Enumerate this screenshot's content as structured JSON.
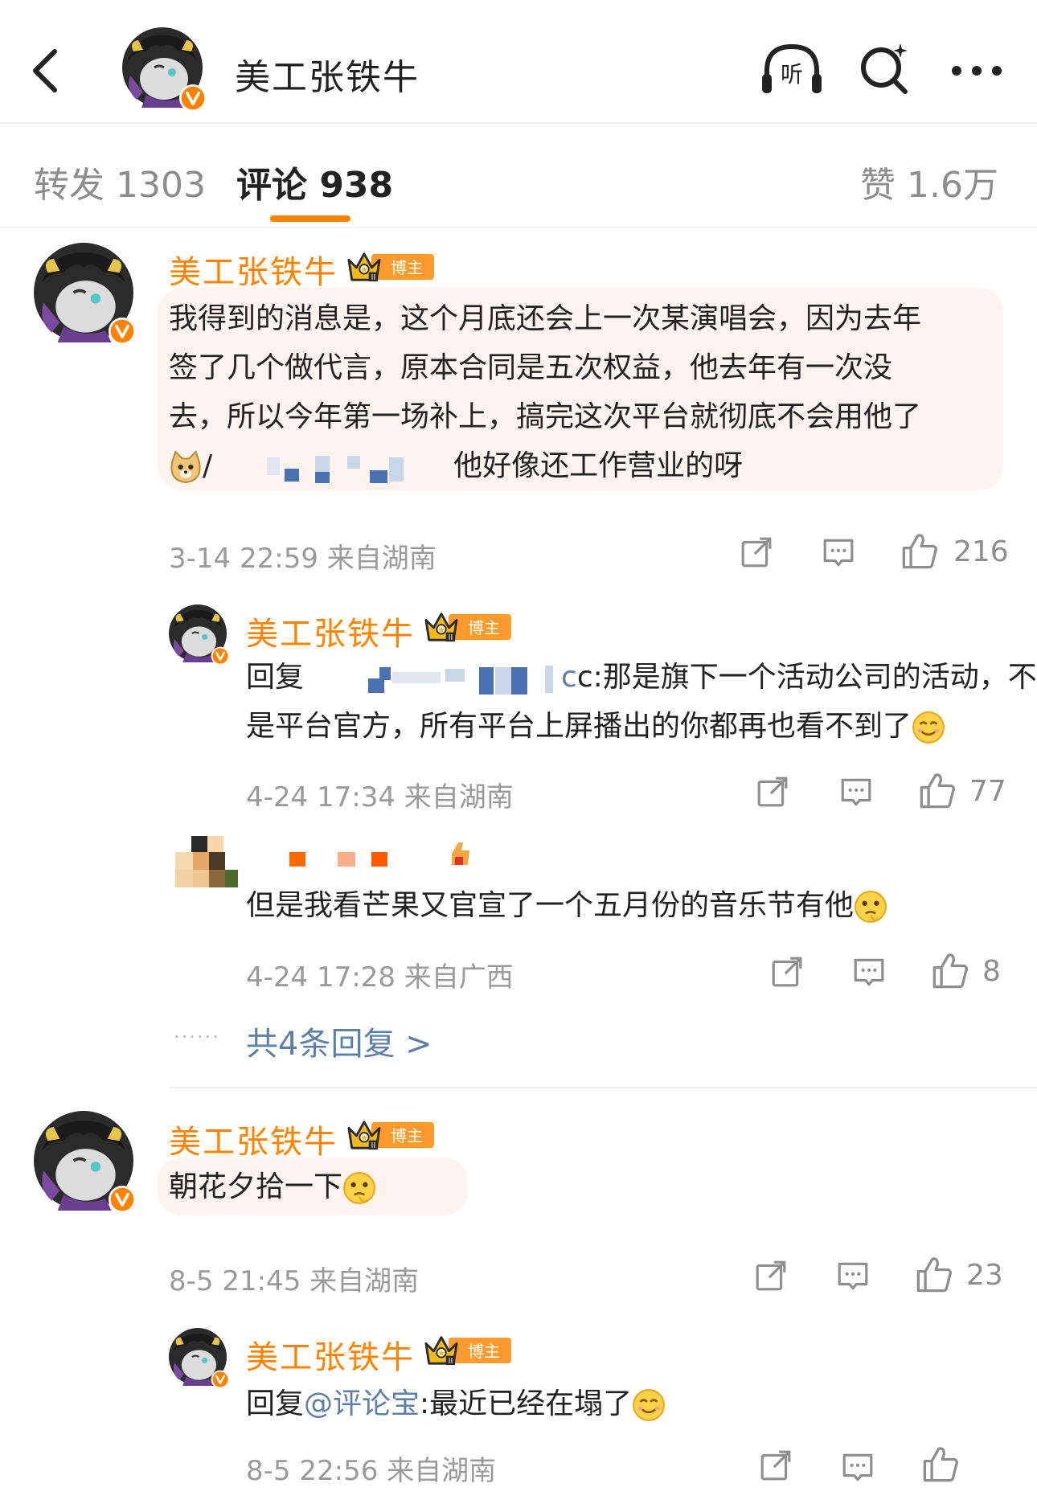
{
  "header": {
    "title": "美工张铁牛",
    "listen_label": "听"
  },
  "tabs": {
    "repost": "转发 1303",
    "comments": "评论 938",
    "likes": "赞 1.6万"
  },
  "badge_label": "博主",
  "colors": {
    "accent": "#ff8200",
    "link": "#5e7fa8",
    "bubble": "#fff3ef"
  },
  "comments": [
    {
      "username": "美工张铁牛",
      "lines": [
        "我得到的消息是，这个月底还会上一次某演唱会，因为去年",
        "签了几个做代言，原本合同是五次权益，他去年有一次没",
        "去，所以今年第一场补上，搞完这次平台就彻底不会用他了"
      ],
      "line4_prefix": "/",
      "line4_suffix": "他好像还工作营业的呀",
      "time": "3-14 22:59",
      "source": "来自湖南",
      "likes": "216"
    },
    {
      "username": "美工张铁牛",
      "reply_prefix": "回复",
      "reply_after_name": "c:那是旗下一个活动公司的活动，不",
      "line2": "是平台官方，所有平台上屏播出的你都再也看不到了",
      "time": "4-24 17:34",
      "source": "来自湖南",
      "likes": "77"
    },
    {
      "text": "但是我看芒果又官宣了一个五月份的音乐节有他",
      "time": "4-24 17:28",
      "source": "来自广西",
      "likes": "8"
    },
    {
      "username": "美工张铁牛",
      "text": "朝花夕拾一下",
      "time": "8-5 21:45",
      "source": "来自湖南",
      "likes": "23"
    },
    {
      "username": "美工张铁牛",
      "reply_prefix": "回复",
      "mention": "@评论宝",
      "reply_text": ":最近已经在塌了",
      "time": "8-5 22:56",
      "source": "来自湖南"
    }
  ],
  "more_replies": "共4条回复 >"
}
